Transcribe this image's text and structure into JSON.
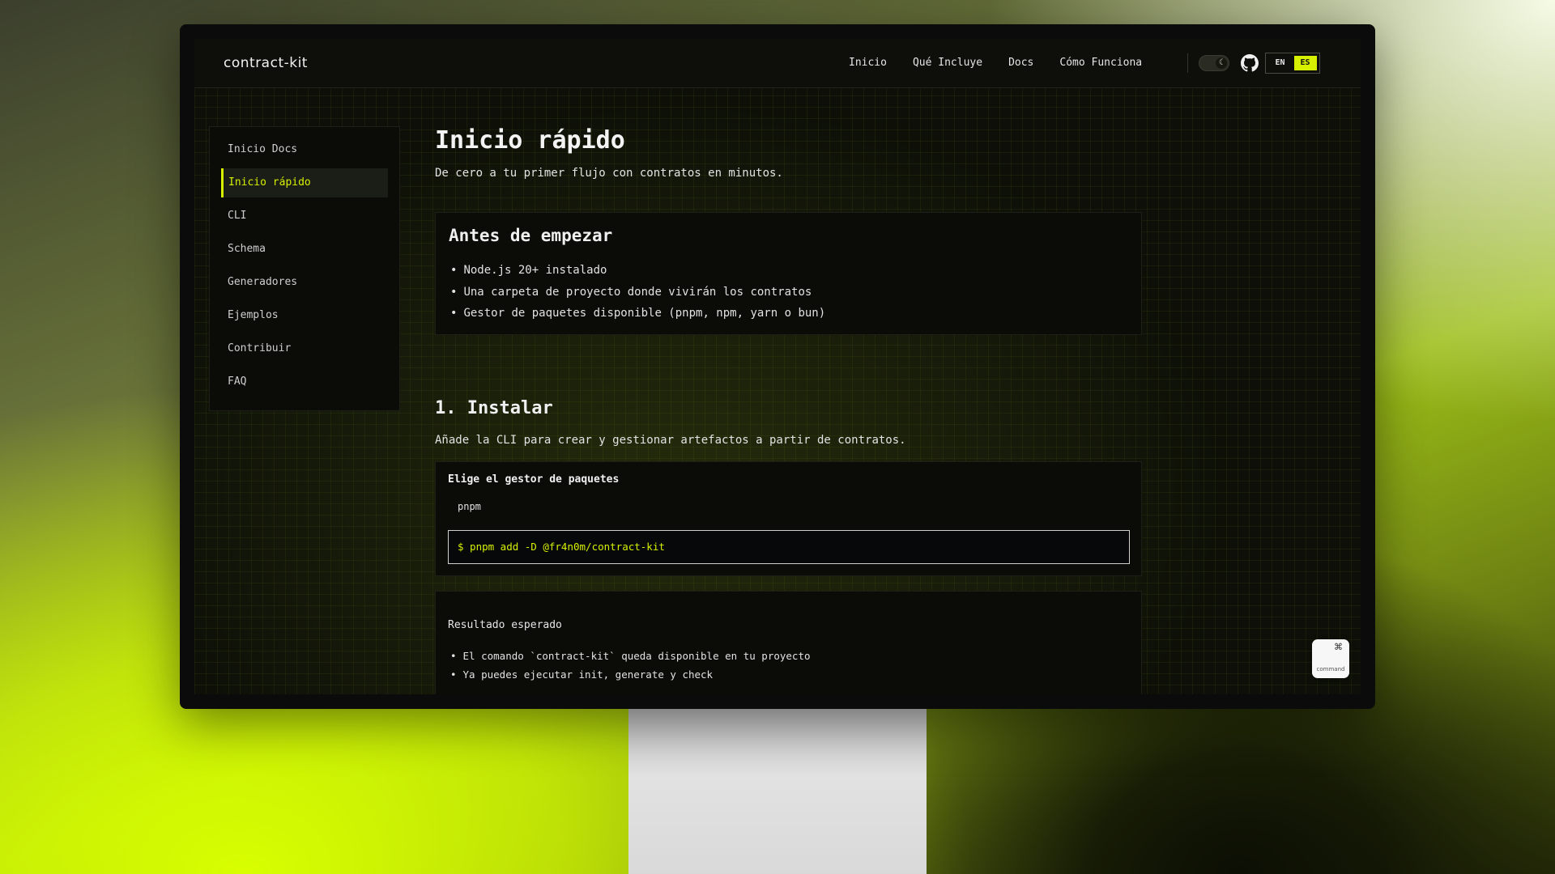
{
  "brand": "contract-kit",
  "nav": {
    "items": [
      "Inicio",
      "Qué Incluye",
      "Docs",
      "Cómo Funciona"
    ]
  },
  "theme_toggle": {
    "icon": "moon-icon"
  },
  "github": {
    "icon": "github-icon"
  },
  "lang": {
    "en": "EN",
    "es": "ES",
    "selected": "ES"
  },
  "colors": {
    "accent": "#d6f000",
    "background": "#0d0f08",
    "panel": "#0b0c08"
  },
  "sidebar": {
    "items": [
      {
        "label": "Inicio Docs",
        "active": false
      },
      {
        "label": "Inicio rápido",
        "active": true
      },
      {
        "label": "CLI",
        "active": false
      },
      {
        "label": "Schema",
        "active": false
      },
      {
        "label": "Generadores",
        "active": false
      },
      {
        "label": "Ejemplos",
        "active": false
      },
      {
        "label": "Contribuir",
        "active": false
      },
      {
        "label": "FAQ",
        "active": false
      }
    ]
  },
  "main": {
    "title": "Inicio rápido",
    "subtitle": "De cero a tu primer flujo con contratos en minutos.",
    "prereq": {
      "title": "Antes de empezar",
      "items": [
        "Node.js 20+ instalado",
        "Una carpeta de proyecto donde vivirán los contratos",
        "Gestor de paquetes disponible (pnpm, npm, yarn o bun)"
      ]
    },
    "install": {
      "title": "1. Instalar",
      "description": "Añade la CLI para crear y gestionar artefactos a partir de contratos.",
      "picker_label": "Elige el gestor de paquetes",
      "selected_manager": "pnpm",
      "command": "$ pnpm add -D @fr4n0m/contract-kit"
    },
    "result": {
      "label": "Resultado esperado",
      "items": [
        "El comando `contract-kit` queda disponible en tu proyecto",
        "Ya puedes ejecutar init, generate y check"
      ]
    }
  },
  "command_widget": {
    "glyph": "⌘",
    "label": "command"
  }
}
